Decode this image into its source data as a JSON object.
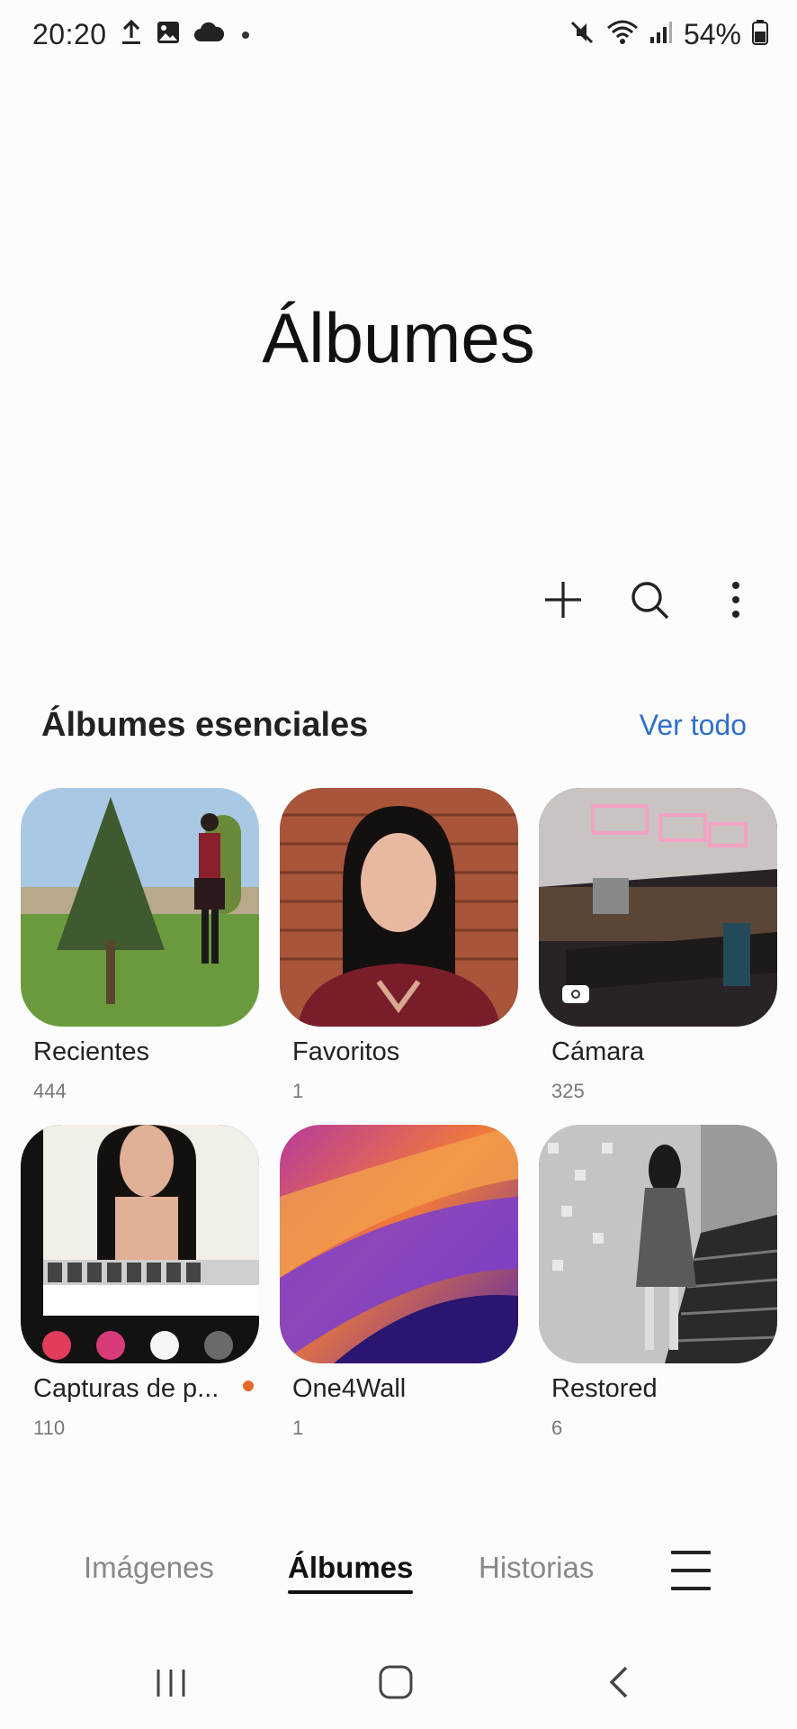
{
  "status_bar": {
    "time": "20:20",
    "battery": "54%",
    "left_icons": [
      "upload-icon",
      "image-icon",
      "cloud-icon",
      "dot-icon"
    ],
    "right_icons": [
      "mute-icon",
      "wifi-icon",
      "signal-icon",
      "battery-icon"
    ]
  },
  "page": {
    "title": "Álbumes"
  },
  "toolbar": {
    "icons": [
      "plus-icon",
      "search-icon",
      "more-vert-icon"
    ]
  },
  "section": {
    "title": "Álbumes esenciales",
    "view_all": "Ver todo"
  },
  "albums": [
    {
      "name": "Recientes",
      "count": "444"
    },
    {
      "name": "Favoritos",
      "count": "1"
    },
    {
      "name": "Cámara",
      "count": "325"
    },
    {
      "name": "Capturas de p...",
      "count": "110"
    },
    {
      "name": "One4Wall",
      "count": "1"
    },
    {
      "name": "Restored",
      "count": "6"
    }
  ],
  "bottom_tabs": {
    "images": "Imágenes",
    "albums": "Álbumes",
    "stories": "Historias",
    "active": "albums"
  },
  "colors": {
    "accent": "#2f6fcf",
    "new_badge": "#e66a2c"
  }
}
